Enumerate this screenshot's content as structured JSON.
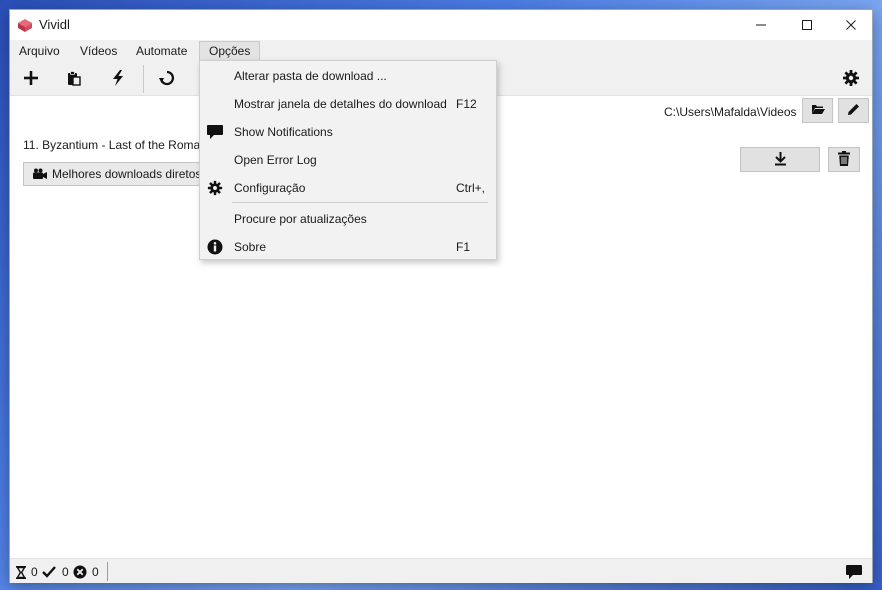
{
  "window": {
    "title": "Vividl"
  },
  "menubar": {
    "items": [
      {
        "label": "Arquivo"
      },
      {
        "label": "Vídeos"
      },
      {
        "label": "Automate"
      },
      {
        "label": "Opções"
      }
    ]
  },
  "toolbar": {
    "icons": [
      "add-icon",
      "paste-icon",
      "lightning-icon",
      "refresh-icon",
      "settings-icon"
    ]
  },
  "download_folder": {
    "path": "C:\\Users\\Mafalda\\Videos"
  },
  "video_item": {
    "title": "11. Byzantium - Last of the Romans",
    "format_selector": "Melhores downloads diretos"
  },
  "options_menu": {
    "items": [
      {
        "label": "Alterar pasta de download ...",
        "shortcut": "",
        "icon": ""
      },
      {
        "label": "Mostrar janela de detalhes do download",
        "shortcut": "F12",
        "icon": ""
      },
      {
        "label": "Show Notifications",
        "shortcut": "",
        "icon": "notification-icon"
      },
      {
        "label": "Open Error Log",
        "shortcut": "",
        "icon": ""
      },
      {
        "label": "Configuração",
        "shortcut": "Ctrl+,",
        "icon": "gear-icon"
      },
      {
        "label": "Procure por atualizações",
        "shortcut": "",
        "icon": ""
      },
      {
        "label": "Sobre",
        "shortcut": "F1",
        "icon": "info-icon"
      }
    ]
  },
  "statusbar": {
    "pending": "0",
    "completed": "0",
    "failed": "0"
  }
}
